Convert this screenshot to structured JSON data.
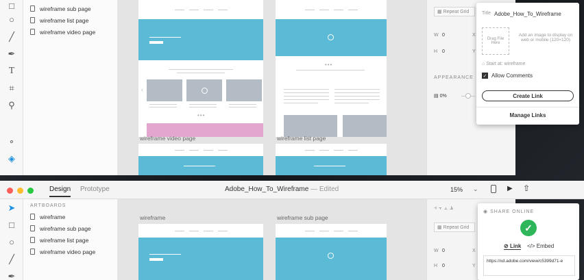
{
  "top": {
    "layers": [
      "wireframe sub page",
      "wireframe list page",
      "wireframe video page"
    ],
    "labels": {
      "video": "wireframe video page",
      "list": "wireframe list page"
    },
    "props": {
      "repeat_grid": "Repeat Grid",
      "w_label": "W",
      "w_value": "0",
      "h_label": "H",
      "h_value": "0",
      "x_label": "X",
      "y_label": "Y",
      "appearance": "APPEARANCE",
      "opacity": "0%"
    },
    "popover": {
      "title_label": "Title",
      "title_value": "Adobe_How_To_Wireframe",
      "drag_text": "Drag File Here",
      "image_hint": "Add an image to display on web or mobile (120×120)",
      "start_at": "Start at: wireframe",
      "allow_comments": "Allow Comments",
      "create_link": "Create Link",
      "manage_links": "Manage Links"
    }
  },
  "bottom": {
    "tabs": {
      "design": "Design",
      "prototype": "Prototype"
    },
    "doc_title": "Adobe_How_To_Wireframe",
    "edited": "— Edited",
    "zoom": "15%",
    "layers_header": "ARTBOARDS",
    "layers": [
      "wireframe",
      "wireframe sub page",
      "wireframe list page",
      "wireframe video page"
    ],
    "labels": {
      "wireframe": "wireframe",
      "sub": "wireframe sub page"
    },
    "props": {
      "repeat_grid": "Repeat Grid",
      "w_label": "W",
      "w_value": "0",
      "h_label": "H",
      "h_value": "0",
      "x_label": "X",
      "y_label": "Y"
    },
    "share": {
      "header": "SHARE ONLINE",
      "tab_link": "Link",
      "tab_embed": "Embed",
      "url": "https://xd.adobe.com/view/c5399d71-e"
    }
  },
  "colors": {
    "accent_blue": "#5bbad6",
    "pink": "#e2a6cf",
    "success": "#2fb55a",
    "close": "#fc5f57",
    "min": "#fdbc2e",
    "max": "#28c840"
  }
}
